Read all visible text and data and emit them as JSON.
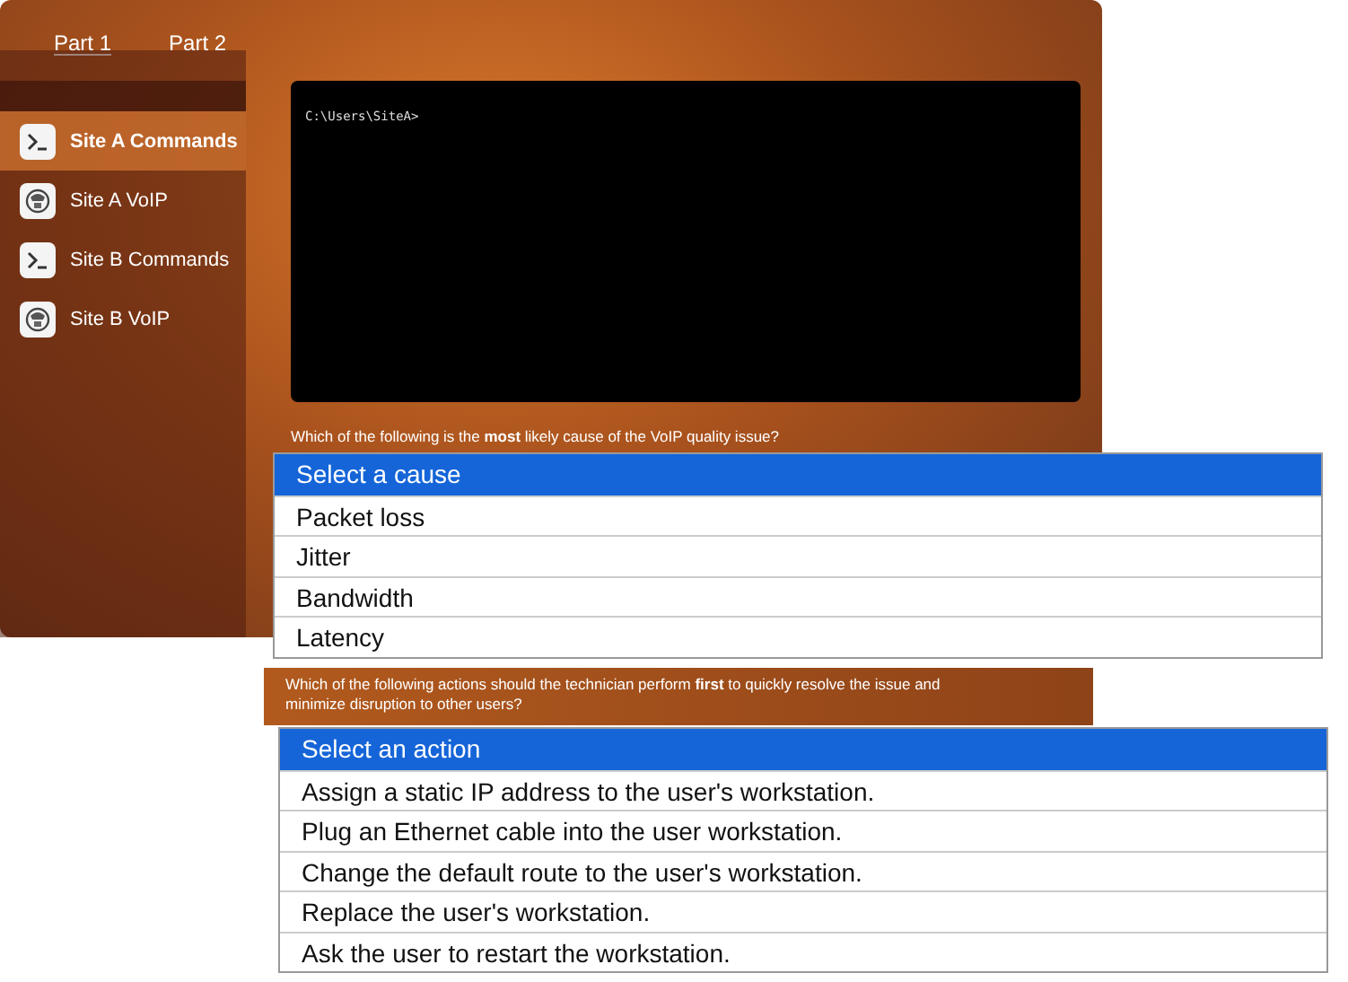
{
  "tabs": [
    {
      "label": "Part 1",
      "selected": true
    },
    {
      "label": "Part 2",
      "selected": false
    }
  ],
  "sidebar": {
    "items": [
      {
        "label": "Site A Commands",
        "kind": "terminal",
        "selected": true
      },
      {
        "label": "Site A VoIP",
        "kind": "voip",
        "selected": false
      },
      {
        "label": "Site B Commands",
        "kind": "terminal",
        "selected": false
      },
      {
        "label": "Site B VoIP",
        "kind": "voip",
        "selected": false
      }
    ]
  },
  "terminal": {
    "prompt": "C:\\Users\\SiteA>"
  },
  "questions": [
    {
      "text": "Which of the following is the **most** likely cause of the VoIP quality issue?",
      "options": [
        {
          "label": "Select a cause",
          "selected": true
        },
        {
          "label": "Packet loss",
          "selected": false
        },
        {
          "label": "Jitter",
          "selected": false
        },
        {
          "label": "Bandwidth",
          "selected": false
        },
        {
          "label": "Latency",
          "selected": false
        }
      ]
    },
    {
      "text": "Which of the following actions should the technician perform **first** to quickly resolve the issue and minimize disruption to other users?",
      "options": [
        {
          "label": "Select an action",
          "selected": true
        },
        {
          "label": "Assign a static IP address to the user's workstation.",
          "selected": false
        },
        {
          "label": "Plug an Ethernet cable into the user workstation.",
          "selected": false
        },
        {
          "label": "Change the default route to the user's workstation.",
          "selected": false
        },
        {
          "label": "Replace the user's workstation.",
          "selected": false
        },
        {
          "label": "Ask the user to restart the workstation.",
          "selected": false
        }
      ]
    }
  ]
}
